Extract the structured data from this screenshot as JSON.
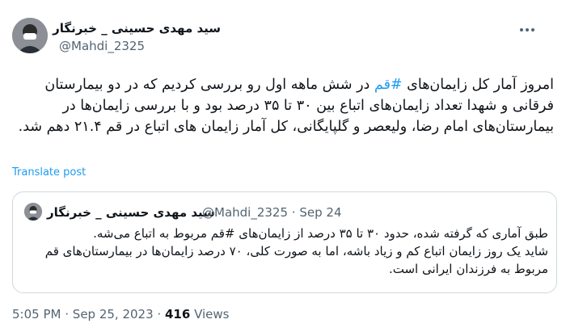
{
  "author": {
    "name": "سید مهدی حسینی _ خبرنگار",
    "handle": "@Mahdi_2325"
  },
  "tweet": {
    "text_before": "امروز آمار کل زایمان‌های ",
    "hashtag": "#قم",
    "text_after": " در شش ماهه اول رو بررسی کردیم که در دو بیمارستان فرقانی و شهدا تعداد زایمان‌های اتباع بین ۳۰ تا ۳۵ درصد بود و با بررسی زایمان‌ها در بیمارستان‌های امام رضا، ولیعصر و گلپایگانی، کل آمار زایمان های اتباع در قم ۲۱.۴ دهم شد."
  },
  "translate_label": "Translate post",
  "quote": {
    "name": "سید مهدی حسینی _ خبرنگار",
    "handle": "@Mahdi_2325",
    "separator": "·",
    "date": "Sep 24",
    "text": "طبق آماری که گرفته شده، حدود ۳۰ تا ۳۵ درصد از زایمان‌های #قم مربوط به اتباع می‌شه.\nشاید یک روز زایمان اتباع کم و زیاد باشه، اما به صورت کلی، ۷۰ درصد زایمان‌ها در بیمارستان‌های قم مربوط به فرزندان ایرانی است."
  },
  "footer": {
    "time": "5:05 PM",
    "separator": "·",
    "date": "Sep 25, 2023",
    "views_count": "416",
    "views_label": "Views"
  },
  "icons": {
    "avatar": "profile-photo",
    "more": "more-horizontal-icon"
  },
  "colors": {
    "link": "#1d9bf0",
    "secondary_text": "#536471",
    "primary_text": "#0f1419",
    "border": "#cfd9de"
  }
}
